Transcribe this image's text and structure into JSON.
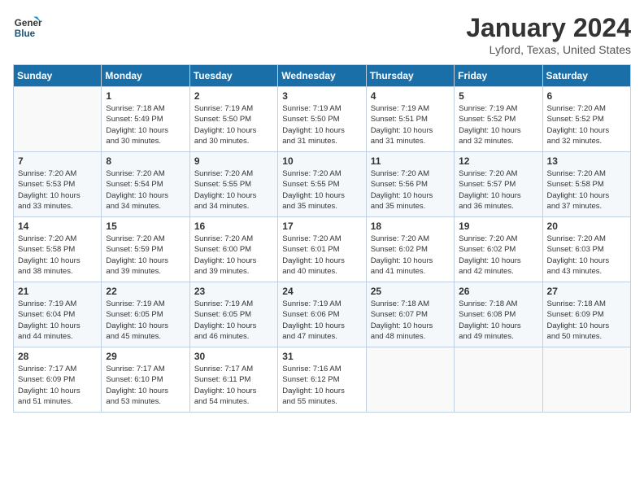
{
  "header": {
    "logo_line1": "General",
    "logo_line2": "Blue",
    "month_year": "January 2024",
    "location": "Lyford, Texas, United States"
  },
  "days_of_week": [
    "Sunday",
    "Monday",
    "Tuesday",
    "Wednesday",
    "Thursday",
    "Friday",
    "Saturday"
  ],
  "weeks": [
    [
      {
        "day": "",
        "info": ""
      },
      {
        "day": "1",
        "info": "Sunrise: 7:18 AM\nSunset: 5:49 PM\nDaylight: 10 hours\nand 30 minutes."
      },
      {
        "day": "2",
        "info": "Sunrise: 7:19 AM\nSunset: 5:50 PM\nDaylight: 10 hours\nand 30 minutes."
      },
      {
        "day": "3",
        "info": "Sunrise: 7:19 AM\nSunset: 5:50 PM\nDaylight: 10 hours\nand 31 minutes."
      },
      {
        "day": "4",
        "info": "Sunrise: 7:19 AM\nSunset: 5:51 PM\nDaylight: 10 hours\nand 31 minutes."
      },
      {
        "day": "5",
        "info": "Sunrise: 7:19 AM\nSunset: 5:52 PM\nDaylight: 10 hours\nand 32 minutes."
      },
      {
        "day": "6",
        "info": "Sunrise: 7:20 AM\nSunset: 5:52 PM\nDaylight: 10 hours\nand 32 minutes."
      }
    ],
    [
      {
        "day": "7",
        "info": "Sunrise: 7:20 AM\nSunset: 5:53 PM\nDaylight: 10 hours\nand 33 minutes."
      },
      {
        "day": "8",
        "info": "Sunrise: 7:20 AM\nSunset: 5:54 PM\nDaylight: 10 hours\nand 34 minutes."
      },
      {
        "day": "9",
        "info": "Sunrise: 7:20 AM\nSunset: 5:55 PM\nDaylight: 10 hours\nand 34 minutes."
      },
      {
        "day": "10",
        "info": "Sunrise: 7:20 AM\nSunset: 5:55 PM\nDaylight: 10 hours\nand 35 minutes."
      },
      {
        "day": "11",
        "info": "Sunrise: 7:20 AM\nSunset: 5:56 PM\nDaylight: 10 hours\nand 35 minutes."
      },
      {
        "day": "12",
        "info": "Sunrise: 7:20 AM\nSunset: 5:57 PM\nDaylight: 10 hours\nand 36 minutes."
      },
      {
        "day": "13",
        "info": "Sunrise: 7:20 AM\nSunset: 5:58 PM\nDaylight: 10 hours\nand 37 minutes."
      }
    ],
    [
      {
        "day": "14",
        "info": "Sunrise: 7:20 AM\nSunset: 5:58 PM\nDaylight: 10 hours\nand 38 minutes."
      },
      {
        "day": "15",
        "info": "Sunrise: 7:20 AM\nSunset: 5:59 PM\nDaylight: 10 hours\nand 39 minutes."
      },
      {
        "day": "16",
        "info": "Sunrise: 7:20 AM\nSunset: 6:00 PM\nDaylight: 10 hours\nand 39 minutes."
      },
      {
        "day": "17",
        "info": "Sunrise: 7:20 AM\nSunset: 6:01 PM\nDaylight: 10 hours\nand 40 minutes."
      },
      {
        "day": "18",
        "info": "Sunrise: 7:20 AM\nSunset: 6:02 PM\nDaylight: 10 hours\nand 41 minutes."
      },
      {
        "day": "19",
        "info": "Sunrise: 7:20 AM\nSunset: 6:02 PM\nDaylight: 10 hours\nand 42 minutes."
      },
      {
        "day": "20",
        "info": "Sunrise: 7:20 AM\nSunset: 6:03 PM\nDaylight: 10 hours\nand 43 minutes."
      }
    ],
    [
      {
        "day": "21",
        "info": "Sunrise: 7:19 AM\nSunset: 6:04 PM\nDaylight: 10 hours\nand 44 minutes."
      },
      {
        "day": "22",
        "info": "Sunrise: 7:19 AM\nSunset: 6:05 PM\nDaylight: 10 hours\nand 45 minutes."
      },
      {
        "day": "23",
        "info": "Sunrise: 7:19 AM\nSunset: 6:05 PM\nDaylight: 10 hours\nand 46 minutes."
      },
      {
        "day": "24",
        "info": "Sunrise: 7:19 AM\nSunset: 6:06 PM\nDaylight: 10 hours\nand 47 minutes."
      },
      {
        "day": "25",
        "info": "Sunrise: 7:18 AM\nSunset: 6:07 PM\nDaylight: 10 hours\nand 48 minutes."
      },
      {
        "day": "26",
        "info": "Sunrise: 7:18 AM\nSunset: 6:08 PM\nDaylight: 10 hours\nand 49 minutes."
      },
      {
        "day": "27",
        "info": "Sunrise: 7:18 AM\nSunset: 6:09 PM\nDaylight: 10 hours\nand 50 minutes."
      }
    ],
    [
      {
        "day": "28",
        "info": "Sunrise: 7:17 AM\nSunset: 6:09 PM\nDaylight: 10 hours\nand 51 minutes."
      },
      {
        "day": "29",
        "info": "Sunrise: 7:17 AM\nSunset: 6:10 PM\nDaylight: 10 hours\nand 53 minutes."
      },
      {
        "day": "30",
        "info": "Sunrise: 7:17 AM\nSunset: 6:11 PM\nDaylight: 10 hours\nand 54 minutes."
      },
      {
        "day": "31",
        "info": "Sunrise: 7:16 AM\nSunset: 6:12 PM\nDaylight: 10 hours\nand 55 minutes."
      },
      {
        "day": "",
        "info": ""
      },
      {
        "day": "",
        "info": ""
      },
      {
        "day": "",
        "info": ""
      }
    ]
  ]
}
